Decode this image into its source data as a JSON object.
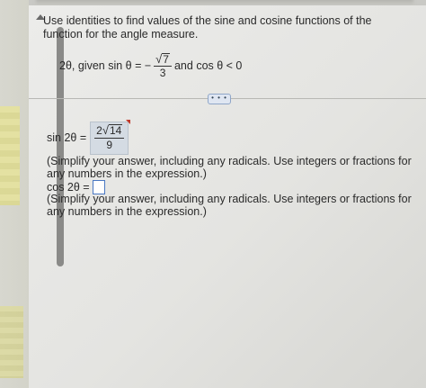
{
  "question": {
    "text": "Use identities to find values of the sine and cosine functions of the function for the angle measure."
  },
  "given": {
    "prefix": "2θ, given sin θ = −",
    "radicand": "7",
    "denominator": "3",
    "suffix": "and cos θ < 0"
  },
  "more_button": {
    "label": "• • •"
  },
  "sin_answer": {
    "label": "sin 2θ =",
    "coefficient": "2",
    "radicand": "14",
    "denominator": "9"
  },
  "notes": {
    "simplify_1": "(Simplify your answer, including any radicals. Use integers or fractions for any numbers in the expression.)",
    "simplify_2": "(Simplify your answer, including any radicals. Use integers or fractions for any numbers in the expression.)"
  },
  "cos_answer": {
    "label": "cos 2θ =",
    "value": ""
  },
  "colors": {
    "panel_bg": "#e8e8e5",
    "answer_box_bg": "#d4dbe3",
    "input_border": "#4a78c2",
    "flag": "#c0392b"
  }
}
